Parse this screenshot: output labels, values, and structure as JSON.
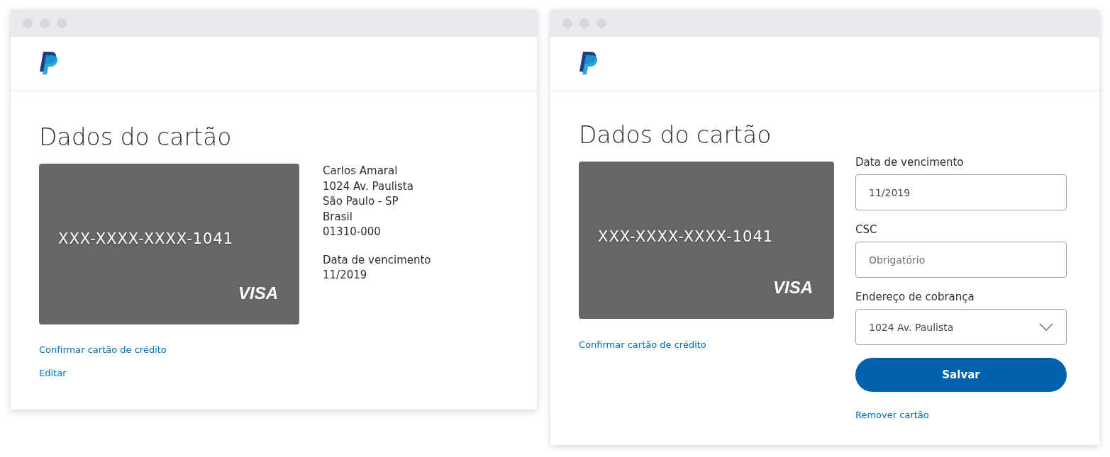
{
  "windows": [
    {
      "kind": "view",
      "heading": "Dados do cartão",
      "card": {
        "number": "XXX-XXXX-XXXX-1041",
        "brand": "VISA"
      },
      "address": [
        "Carlos Amaral",
        "1024 Av. Paulista",
        "São Paulo - SP",
        "Brasil",
        "01310-000"
      ],
      "expiry": {
        "label": "Data de vencimento",
        "value": "11/2019"
      },
      "links": [
        "Confirmar cartão de crédito",
        "Editar"
      ]
    },
    {
      "kind": "edit",
      "heading": "Dados do cartão",
      "card": {
        "number": "XXX-XXXX-XXXX-1041",
        "brand": "VISA"
      },
      "links": [
        "Confirmar cartão de crédito"
      ],
      "fields": [
        {
          "kind": "input",
          "label": "Data de vencimento",
          "value": "11/2019"
        },
        {
          "kind": "input",
          "label": "CSC",
          "placeholder": "Obrigatório"
        },
        {
          "kind": "select",
          "label": "Endereço de cobrança",
          "value": "1024 Av. Paulista"
        }
      ],
      "button": "Salvar",
      "form_link": "Remover cartão"
    }
  ]
}
